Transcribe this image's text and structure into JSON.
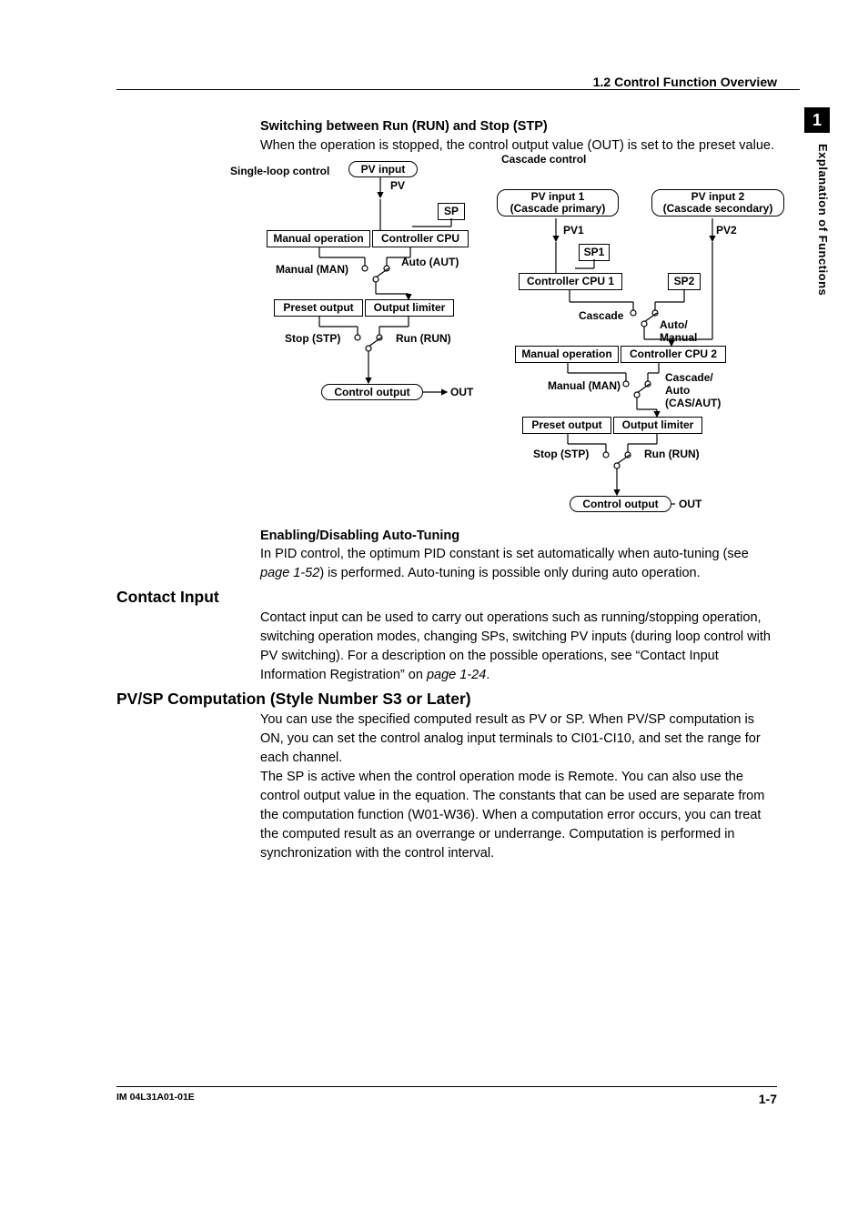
{
  "header": {
    "section": "1.2  Control Function Overview"
  },
  "sidebar": {
    "chapter": "1",
    "title": "Explanation of Functions"
  },
  "subheads": {
    "switching": "Switching between Run (RUN) and Stop (STP)",
    "switching_body": "When the operation is stopped, the control output value (OUT) is set to the preset value.",
    "autotune": "Enabling/Disabling Auto-Tuning",
    "autotune_body_a": "In PID control, the optimum PID constant is set automatically when auto-tuning (see ",
    "autotune_pageref": "page 1-52",
    "autotune_body_b": ") is performed.  Auto-tuning is possible only during auto operation."
  },
  "contact": {
    "heading": "Contact Input",
    "body_a": "Contact input can be used to carry out operations such as running/stopping operation, switching operation modes, changing SPs, switching PV inputs (during loop control with PV switching). For a description on the possible operations, see “Contact Input Information Registration” on ",
    "pageref": "page 1-24",
    "body_b": "."
  },
  "pvsp": {
    "heading": "PV/SP Computation (Style Number S3 or Later)",
    "p1": "You can use the specified computed result as PV or SP.  When PV/SP computation is ON, you can set the control analog input terminals to CI01-CI10, and set the range for each channel.",
    "p2": "The SP is active when the control operation mode is Remote.  You can also use the control output value in the equation.  The constants that can be used are separate from the computation function (W01-W36).  When a computation error occurs, you can treat the computed result as an overrange or underrange.  Computation is performed in synchronization with the control interval."
  },
  "diag": {
    "single_loop": "Single-loop control",
    "cascade_control": "Cascade control",
    "pv_input": "PV input",
    "pv": "PV",
    "sp": "SP",
    "manual_op": "Manual operation",
    "controller_cpu": "Controller CPU",
    "manual_man": "Manual (MAN)",
    "auto_aut": "Auto (AUT)",
    "preset_output": "Preset output",
    "output_limiter": "Output limiter",
    "stop_stp": "Stop (STP)",
    "run_run": "Run (RUN)",
    "control_output": "Control output",
    "out": "OUT",
    "pv_input1": "PV input 1",
    "pv_input1_sub": "(Cascade primary)",
    "pv_input2": "PV input 2",
    "pv_input2_sub": "(Cascade secondary)",
    "pv1": "PV1",
    "pv2": "PV2",
    "sp1": "SP1",
    "controller_cpu1": "Controller CPU 1",
    "sp2": "SP2",
    "cascade": "Cascade",
    "auto_manual": "Auto/",
    "auto_manual2": "Manual",
    "controller_cpu2": "Controller CPU 2",
    "cascade_auto": "Cascade/",
    "cascade_auto2": "Auto",
    "cascade_auto3": "(CAS/AUT)"
  },
  "footer": {
    "left": "IM 04L31A01-01E",
    "right": "1-7"
  }
}
